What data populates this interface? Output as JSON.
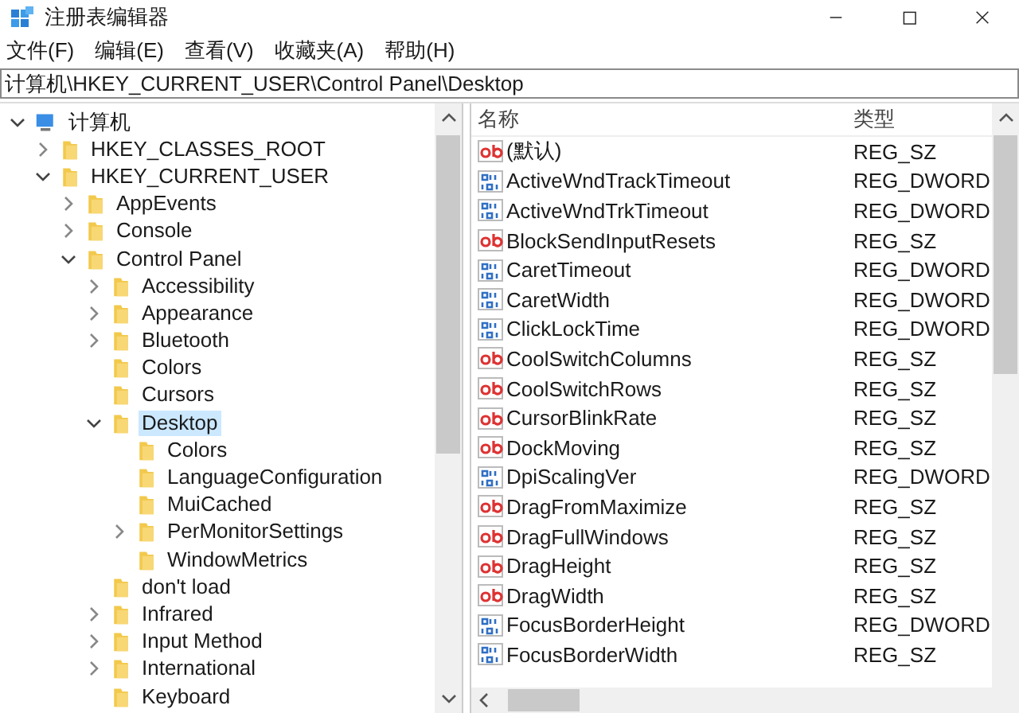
{
  "window": {
    "title": "注册表编辑器"
  },
  "menu": [
    "文件(F)",
    "编辑(E)",
    "查看(V)",
    "收藏夹(A)",
    "帮助(H)"
  ],
  "address": {
    "value": "计算机\\HKEY_CURRENT_USER\\Control Panel\\Desktop"
  },
  "tree": [
    {
      "label": "计算机",
      "kind": "computer",
      "expanded": true,
      "selected": false,
      "children": [
        {
          "label": "HKEY_CLASSES_ROOT",
          "expanded": false,
          "selected": false
        },
        {
          "label": "HKEY_CURRENT_USER",
          "expanded": true,
          "selected": false,
          "children": [
            {
              "label": "AppEvents",
              "expanded": false,
              "selected": false
            },
            {
              "label": "Console",
              "expanded": false,
              "selected": false
            },
            {
              "label": "Control Panel",
              "expanded": true,
              "selected": false,
              "children": [
                {
                  "label": "Accessibility",
                  "expanded": false,
                  "selected": false
                },
                {
                  "label": "Appearance",
                  "expanded": false,
                  "selected": false
                },
                {
                  "label": "Bluetooth",
                  "expanded": false,
                  "selected": false
                },
                {
                  "label": "Colors",
                  "selected": false
                },
                {
                  "label": "Cursors",
                  "selected": false
                },
                {
                  "label": "Desktop",
                  "expanded": true,
                  "selected": true,
                  "children": [
                    {
                      "label": "Colors",
                      "selected": false
                    },
                    {
                      "label": "LanguageConfiguration",
                      "selected": false
                    },
                    {
                      "label": "MuiCached",
                      "selected": false
                    },
                    {
                      "label": "PerMonitorSettings",
                      "expanded": false,
                      "selected": false
                    },
                    {
                      "label": "WindowMetrics",
                      "selected": false
                    }
                  ]
                },
                {
                  "label": "don't load",
                  "selected": false
                },
                {
                  "label": "Infrared",
                  "expanded": false,
                  "selected": false
                },
                {
                  "label": "Input Method",
                  "expanded": false,
                  "selected": false
                },
                {
                  "label": "International",
                  "expanded": false,
                  "selected": false
                },
                {
                  "label": "Keyboard",
                  "selected": false
                }
              ]
            }
          ]
        }
      ]
    }
  ],
  "values": {
    "columns": [
      "名称",
      "类型"
    ],
    "rows": [
      {
        "name": "(默认)",
        "kind": "string",
        "type": "REG_SZ"
      },
      {
        "name": "ActiveWndTrackTimeout",
        "kind": "dword",
        "type": "REG_DWORD"
      },
      {
        "name": "ActiveWndTrkTimeout",
        "kind": "dword",
        "type": "REG_DWORD"
      },
      {
        "name": "BlockSendInputResets",
        "kind": "string",
        "type": "REG_SZ"
      },
      {
        "name": "CaretTimeout",
        "kind": "dword",
        "type": "REG_DWORD"
      },
      {
        "name": "CaretWidth",
        "kind": "dword",
        "type": "REG_DWORD"
      },
      {
        "name": "ClickLockTime",
        "kind": "dword",
        "type": "REG_DWORD"
      },
      {
        "name": "CoolSwitchColumns",
        "kind": "string",
        "type": "REG_SZ"
      },
      {
        "name": "CoolSwitchRows",
        "kind": "string",
        "type": "REG_SZ"
      },
      {
        "name": "CursorBlinkRate",
        "kind": "string",
        "type": "REG_SZ"
      },
      {
        "name": "DockMoving",
        "kind": "string",
        "type": "REG_SZ"
      },
      {
        "name": "DpiScalingVer",
        "kind": "dword",
        "type": "REG_DWORD"
      },
      {
        "name": "DragFromMaximize",
        "kind": "string",
        "type": "REG_SZ"
      },
      {
        "name": "DragFullWindows",
        "kind": "string",
        "type": "REG_SZ"
      },
      {
        "name": "DragHeight",
        "kind": "string",
        "type": "REG_SZ"
      },
      {
        "name": "DragWidth",
        "kind": "string",
        "type": "REG_SZ"
      },
      {
        "name": "FocusBorderHeight",
        "kind": "dword",
        "type": "REG_DWORD"
      },
      {
        "name": "FocusBorderWidth",
        "kind": "dword",
        "type": "REG_SZ"
      }
    ]
  }
}
